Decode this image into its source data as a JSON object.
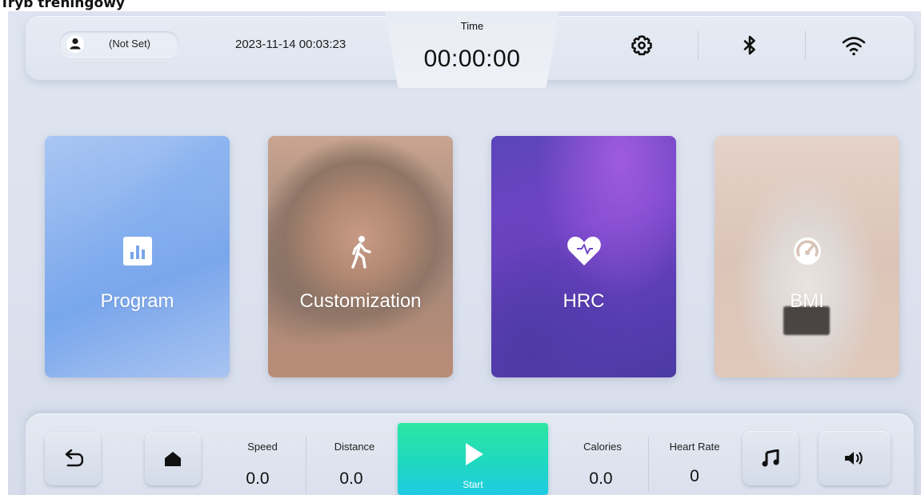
{
  "document": {
    "heading": "Tryb treningowy"
  },
  "header": {
    "user": {
      "name": "(Not Set)"
    },
    "datetime": "2023-11-14 00:03:23",
    "time": {
      "label": "Time",
      "value": "00:00:00"
    },
    "icons": [
      "settings-icon",
      "bluetooth-icon",
      "wifi-icon"
    ]
  },
  "modes": [
    {
      "label": "Program",
      "icon": "bar-chart-icon"
    },
    {
      "label": "Customization",
      "icon": "walking-person-icon"
    },
    {
      "label": "HRC",
      "icon": "heart-icon"
    },
    {
      "label": "BMI",
      "icon": "gauge-icon"
    }
  ],
  "footer": {
    "back_icon": "back-arrow-icon",
    "home_icon": "home-icon",
    "speed": {
      "label": "Speed",
      "value": "0.0"
    },
    "distance": {
      "label": "Distance",
      "value": "0.0"
    },
    "start": {
      "label": "Start",
      "icon": "play-icon"
    },
    "calories": {
      "label": "Calories",
      "value": "0.0"
    },
    "heart_rate": {
      "label": "Heart Rate",
      "value": "0"
    },
    "music_icon": "music-icon",
    "volume_icon": "volume-icon"
  },
  "colors": {
    "background": "#dce2ee",
    "start_gradient_top": "#2ce7a2",
    "start_gradient_bottom": "#1fcbe2",
    "hrc_card": "#6a44c2",
    "program_card": "#8db3ee"
  }
}
